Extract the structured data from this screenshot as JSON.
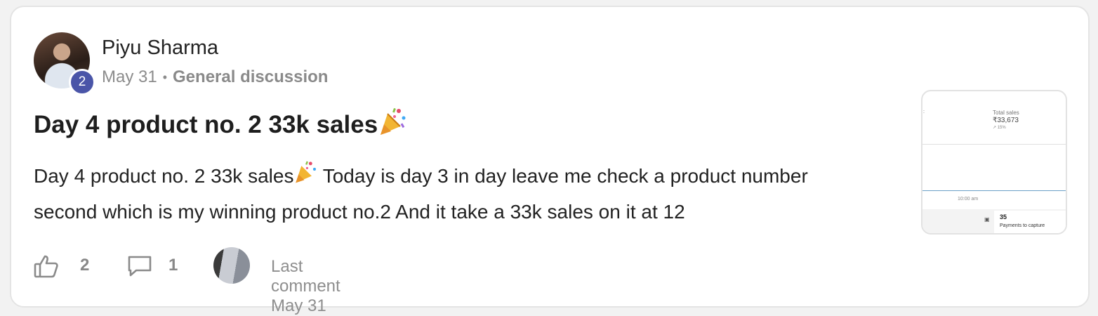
{
  "post": {
    "author": "Piyu Sharma",
    "level": "2",
    "date": "May 31",
    "separator": "•",
    "category": "General discussion",
    "title": "Day 4 product no. 2 33k sales",
    "body": "Day 4 product no. 2 33k sales",
    "body_rest": " Today is day 3 in day leave me check a product number second which is my winning product no.2 And it take a 33k sales on it at 12",
    "emoji": "party-popper-icon"
  },
  "thumbnail": {
    "label": "Total sales",
    "value": "₹33,673",
    "delta": "↗ 15%",
    "time": "10:00 am",
    "count": "35",
    "count_label": "Payments to capture",
    "mark": ":"
  },
  "footer": {
    "likes": "2",
    "comments": "1",
    "last_comment": "Last comment May 31"
  },
  "colors": {
    "badge": "#4a55a8",
    "muted": "#8c8c8c",
    "card_border": "#e4e4e4"
  }
}
